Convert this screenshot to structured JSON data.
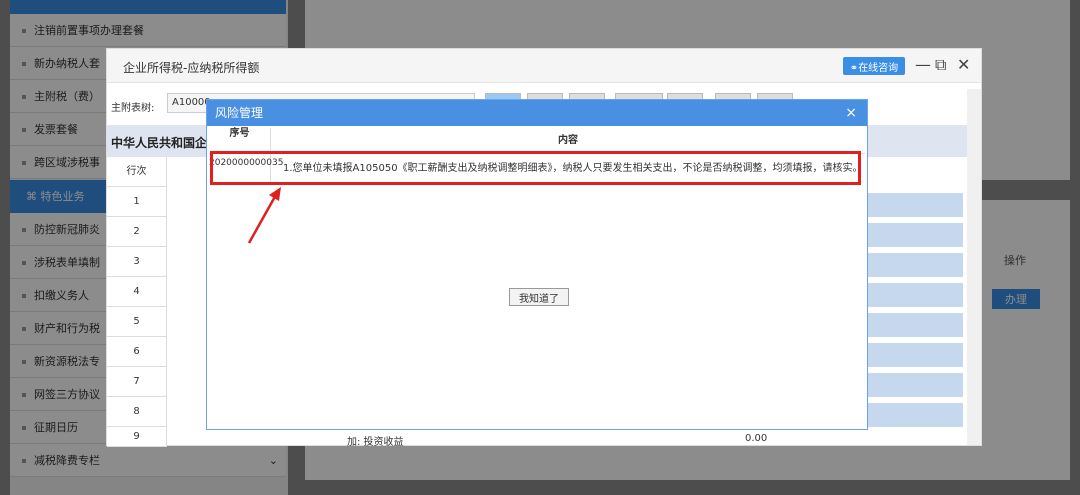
{
  "sidebar": {
    "items": [
      {
        "label": "注销前置事项办理套餐"
      },
      {
        "label": "新办纳税人套"
      },
      {
        "label": "主附税（费）"
      },
      {
        "label": "发票套餐"
      },
      {
        "label": "跨区域涉税事"
      }
    ],
    "special_header": "特色业务",
    "special_items": [
      {
        "label": "防控新冠肺炎"
      },
      {
        "label": "涉税表单填制"
      },
      {
        "label": "扣缴义务人"
      },
      {
        "label": "财产和行为税"
      },
      {
        "label": "新资源税法专"
      },
      {
        "label": "网签三方协议"
      },
      {
        "label": "征期日历"
      },
      {
        "label": "减税降费专栏"
      }
    ]
  },
  "right": {
    "ops_label": "操作",
    "ops_button": "办理"
  },
  "window": {
    "title": "企业所得税-应纳税所得额",
    "consult_button": "在线咨询",
    "toolbar_label": "主附表树:",
    "toolbar_value": "A10000",
    "form_header": "中华人民共和国企",
    "row_header": "行次",
    "rows": [
      "1",
      "2",
      "3",
      "4",
      "5",
      "6",
      "7",
      "8",
      "9"
    ],
    "row9_label": "加: 投资收益",
    "row9_value": "0.00"
  },
  "modal": {
    "title": "风险管理",
    "close": "×",
    "col_seq": "序号",
    "col_content": "内容",
    "seq_value": "2020000000035",
    "content_value": "1.您单位未填报A105050《职工薪酬支出及纳税调整明细表》，纳税人只要发生相关支出，不论是否纳税调整，均须填报，请核实。",
    "ok_button": "我知道了"
  },
  "colors": {
    "accent": "#3a8ee6",
    "modal_header": "#4a90e2",
    "highlight": "#e02020"
  }
}
